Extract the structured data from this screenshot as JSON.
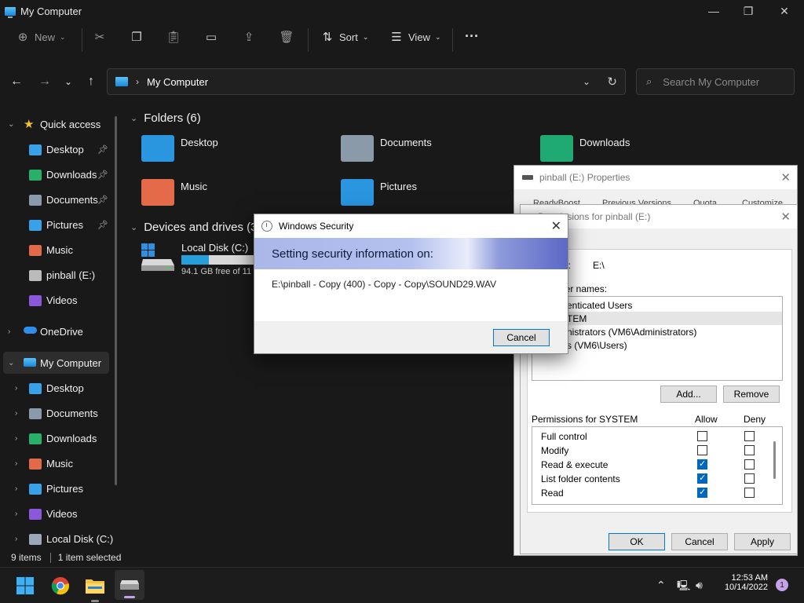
{
  "window": {
    "title": "My Computer",
    "minimize": "—",
    "maximize": "❐",
    "close": "✕"
  },
  "toolbar": {
    "new_label": "New",
    "sort_label": "Sort",
    "view_label": "View",
    "more": "···"
  },
  "address": {
    "crumb": "My Computer",
    "search_placeholder": "Search My Computer"
  },
  "sidebar": {
    "quick_access": "Quick access",
    "quick_items": [
      {
        "label": "Desktop",
        "icon": "desktop-icon",
        "color": "#3aa0e8"
      },
      {
        "label": "Downloads",
        "icon": "download-icon",
        "color": "#28b06a"
      },
      {
        "label": "Documents",
        "icon": "document-icon",
        "color": "#8a9aa8"
      },
      {
        "label": "Pictures",
        "icon": "picture-icon",
        "color": "#3aa0e8"
      },
      {
        "label": "Music",
        "icon": "music-icon",
        "color": "#e06a4a"
      },
      {
        "label": "pinball (E:)",
        "icon": "drive-icon",
        "color": "#bbbbbb"
      },
      {
        "label": "Videos",
        "icon": "video-icon",
        "color": "#8a58d8"
      }
    ],
    "onedrive": "OneDrive",
    "my_computer": "My Computer",
    "pc_items": [
      {
        "label": "Desktop",
        "icon": "desktop-icon",
        "color": "#3aa0e8"
      },
      {
        "label": "Documents",
        "icon": "document-icon",
        "color": "#8a9aa8"
      },
      {
        "label": "Downloads",
        "icon": "download-icon",
        "color": "#28b06a"
      },
      {
        "label": "Music",
        "icon": "music-icon",
        "color": "#e06a4a"
      },
      {
        "label": "Pictures",
        "icon": "picture-icon",
        "color": "#3aa0e8"
      },
      {
        "label": "Videos",
        "icon": "video-icon",
        "color": "#8a58d8"
      },
      {
        "label": "Local Disk (C:)",
        "icon": "drive-icon",
        "color": "#9aa8b8"
      }
    ]
  },
  "content": {
    "folders_header": "Folders (6)",
    "folders": [
      {
        "label": "Desktop",
        "color": "#2a96e0"
      },
      {
        "label": "Documents",
        "color": "#8a9aa8"
      },
      {
        "label": "Downloads",
        "color": "#1faa74"
      },
      {
        "label": "Music",
        "color": "#e46a4a"
      },
      {
        "label": "Pictures",
        "color": "#2a96e0"
      }
    ],
    "drives_header": "Devices and drives (3)",
    "drive": {
      "name": "Local Disk (C:)",
      "free": "94.1 GB free of 11",
      "used_fraction": 0.35
    }
  },
  "status": {
    "items": "9 items",
    "selected": "1 item selected"
  },
  "properties": {
    "title": "pinball (E:) Properties",
    "tabs": [
      "ReadyBoost",
      "Previous Versions",
      "Quota",
      "Customize"
    ]
  },
  "permissions": {
    "title": "Permissions for pinball (E:)",
    "object_label": "me:",
    "object_value": "E:\\",
    "group_label": "user names:",
    "users": [
      "enticated Users",
      "TEM",
      "nistrators (VM6\\Administrators)",
      "s (VM6\\Users)"
    ],
    "add": "Add...",
    "remove": "Remove",
    "perm_for": "Permissions for SYSTEM",
    "allow": "Allow",
    "deny": "Deny",
    "rows": [
      {
        "name": "Full control",
        "allow": false,
        "deny": false
      },
      {
        "name": "Modify",
        "allow": false,
        "deny": false
      },
      {
        "name": "Read & execute",
        "allow": true,
        "deny": false
      },
      {
        "name": "List folder contents",
        "allow": true,
        "deny": false
      },
      {
        "name": "Read",
        "allow": true,
        "deny": false
      }
    ],
    "ok": "OK",
    "cancel": "Cancel",
    "apply": "Apply"
  },
  "security": {
    "title": "Windows Security",
    "heading": "Setting security information on:",
    "path": "E:\\pinball - Copy (400) - Copy - Copy\\SOUND29.WAV",
    "cancel": "Cancel"
  },
  "taskbar": {
    "time": "12:53 AM",
    "date": "10/14/2022",
    "badge": "1"
  }
}
